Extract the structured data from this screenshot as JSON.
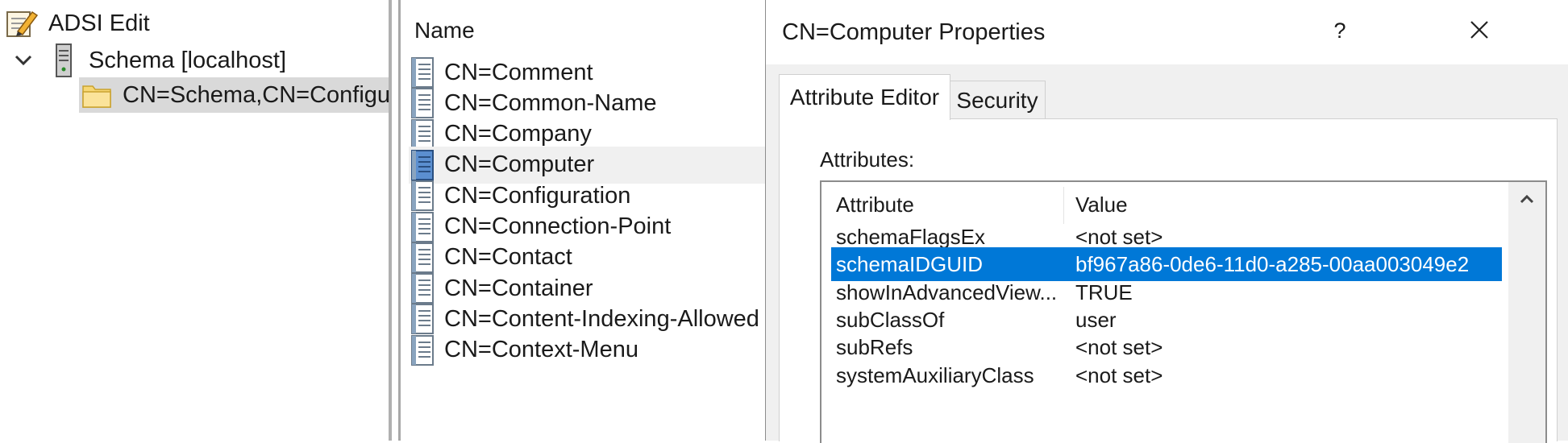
{
  "tree": {
    "root_label": "ADSI Edit",
    "schema_label": "Schema [localhost]",
    "node_label": "CN=Schema,CN=Configuration"
  },
  "list": {
    "header": "Name",
    "items": [
      {
        "label": "CN=Comment",
        "selected": false
      },
      {
        "label": "CN=Common-Name",
        "selected": false
      },
      {
        "label": "CN=Company",
        "selected": false
      },
      {
        "label": "CN=Computer",
        "selected": true
      },
      {
        "label": "CN=Configuration",
        "selected": false
      },
      {
        "label": "CN=Connection-Point",
        "selected": false
      },
      {
        "label": "CN=Contact",
        "selected": false
      },
      {
        "label": "CN=Container",
        "selected": false
      },
      {
        "label": "CN=Content-Indexing-Allowed",
        "selected": false
      },
      {
        "label": "CN=Context-Menu",
        "selected": false
      }
    ]
  },
  "dialog": {
    "title": "CN=Computer Properties",
    "help_label": "?",
    "tabs": [
      "Attribute Editor",
      "Security"
    ],
    "active_tab": "Attribute Editor",
    "attributes_label": "Attributes:",
    "columns": [
      "Attribute",
      "Value"
    ],
    "rows": [
      {
        "attribute": "schemaFlagsEx",
        "value": "<not set>",
        "selected": false
      },
      {
        "attribute": "schemaIDGUID",
        "value": "bf967a86-0de6-11d0-a285-00aa003049e2",
        "selected": true
      },
      {
        "attribute": "showInAdvancedView...",
        "value": "TRUE",
        "selected": false
      },
      {
        "attribute": "subClassOf",
        "value": "user",
        "selected": false
      },
      {
        "attribute": "subRefs",
        "value": "<not set>",
        "selected": false
      },
      {
        "attribute": "systemAuxiliaryClass",
        "value": "<not set>",
        "selected": false
      }
    ]
  },
  "colors": {
    "selection": "#0078d7",
    "tree_selection": "#d9d9d9",
    "dialog_bg": "#f0f0f0"
  },
  "icons": {
    "root": "adsi-edit-icon",
    "schema": "server-icon",
    "node": "folder-icon",
    "list_item": "schema-class-document-icon",
    "close": "close-icon",
    "scroll_up": "scroll-up-arrow-icon"
  }
}
